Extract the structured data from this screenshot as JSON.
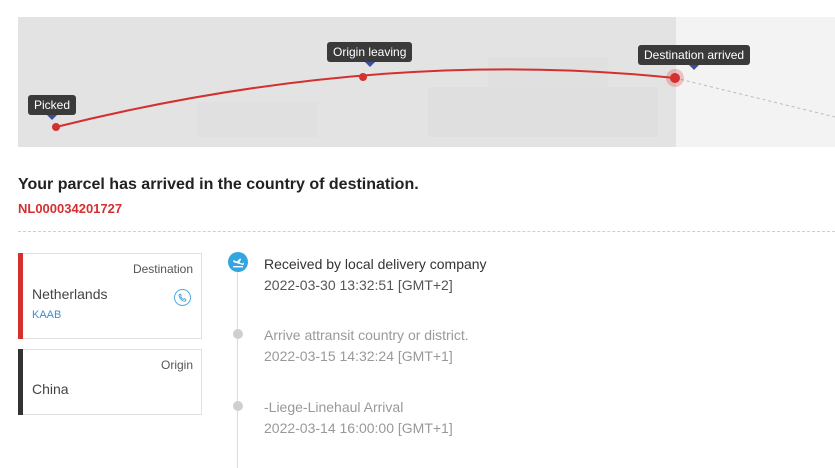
{
  "map": {
    "milestones": [
      {
        "label": "Picked"
      },
      {
        "label": "Origin leaving"
      },
      {
        "label": "Destination arrived"
      }
    ],
    "route_color": "#d3302f"
  },
  "status": {
    "headline": "Your parcel has arrived in the country of destination.",
    "tracking_number": "NL000034201727"
  },
  "destination": {
    "kind": "Destination",
    "country": "Netherlands",
    "carrier": "KAAB",
    "icon": "phone-icon",
    "accent": "#d3302f"
  },
  "origin": {
    "kind": "Origin",
    "country": "China",
    "accent": "#333333"
  },
  "events": [
    {
      "title": "Received by local delivery company",
      "time": "2022-03-30 13:32:51 [GMT+2]",
      "icon": "airplane-landing-icon"
    },
    {
      "title": "Arrive attransit country or district.",
      "time": "2022-03-15 14:32:24 [GMT+1]"
    },
    {
      "title": "-Liege-Linehaul Arrival",
      "time": "2022-03-14 16:00:00 [GMT+1]"
    }
  ]
}
